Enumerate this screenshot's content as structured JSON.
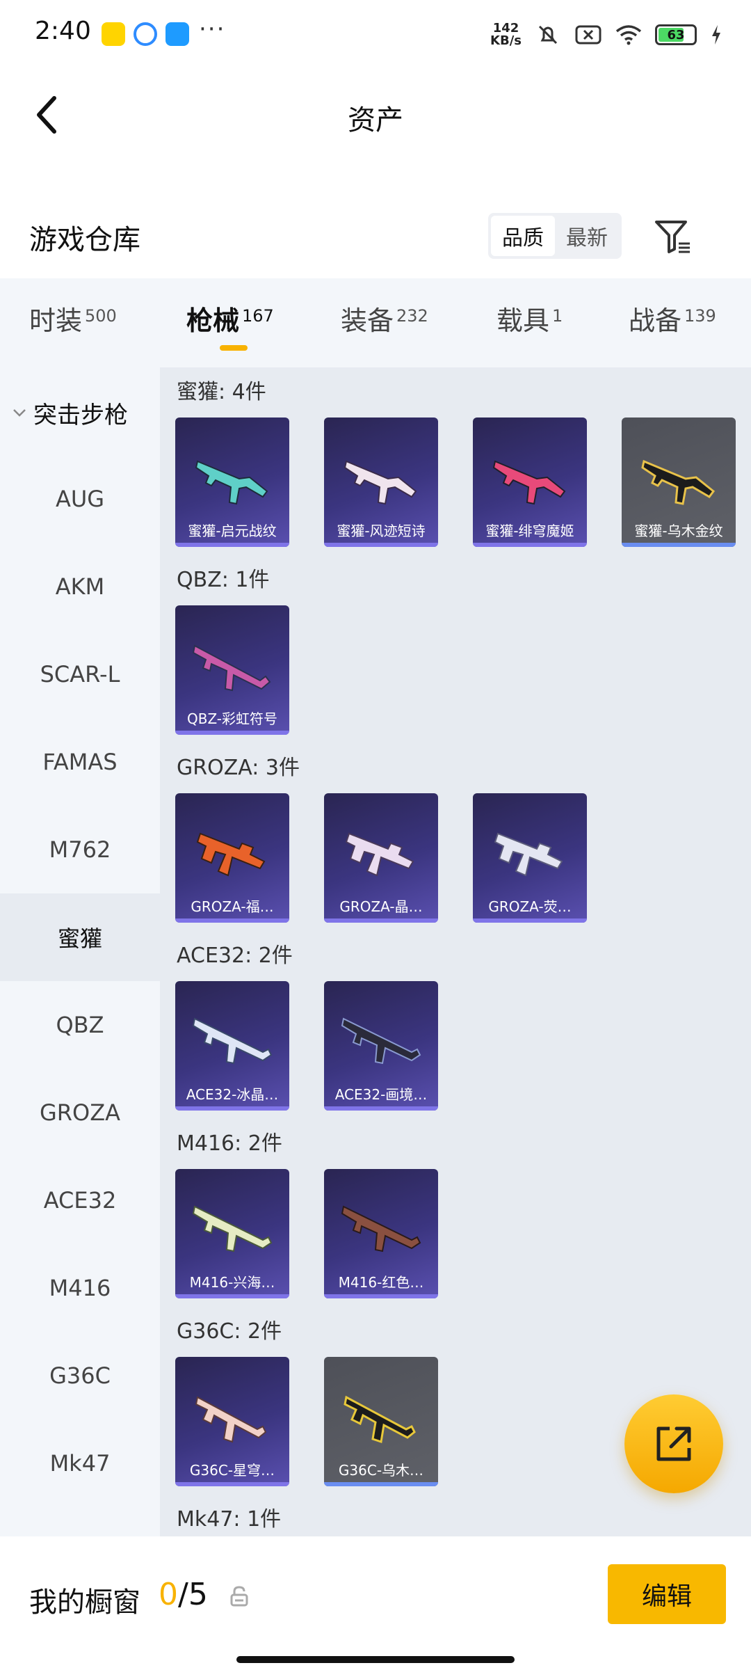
{
  "status_bar": {
    "time": "2:40",
    "net_speed_value": "142",
    "net_speed_unit": "KB/s",
    "battery": "63",
    "icons": [
      "app-icon-1",
      "app-icon-2",
      "app-icon-3",
      "more-dots-icon",
      "mute-icon",
      "no-sim-icon",
      "wifi-icon",
      "battery-icon",
      "charging-icon"
    ]
  },
  "header": {
    "title": "资产",
    "back_icon": "chevron-left-icon"
  },
  "warehouse": {
    "title": "游戏仓库",
    "sort_options": [
      {
        "label": "品质",
        "active": true
      },
      {
        "label": "最新",
        "active": false
      }
    ],
    "filter_icon": "filter-icon"
  },
  "tabs": [
    {
      "label": "时装",
      "count": "500",
      "active": false
    },
    {
      "label": "枪械",
      "count": "167",
      "active": true
    },
    {
      "label": "装备",
      "count": "232",
      "active": false
    },
    {
      "label": "载具",
      "count": "1",
      "active": false
    },
    {
      "label": "战备",
      "count": "139",
      "active": false
    }
  ],
  "sidebar": {
    "group_label": "突击步枪",
    "items": [
      {
        "label": "AUG"
      },
      {
        "label": "AKM"
      },
      {
        "label": "SCAR-L"
      },
      {
        "label": "FAMAS"
      },
      {
        "label": "M762"
      },
      {
        "label": "蜜獾",
        "active": true
      },
      {
        "label": "QBZ"
      },
      {
        "label": "GROZA"
      },
      {
        "label": "ACE32"
      },
      {
        "label": "M416"
      },
      {
        "label": "G36C"
      },
      {
        "label": "Mk47"
      }
    ]
  },
  "sections": [
    {
      "title": "蜜獾: 4件",
      "items": [
        {
          "label": "蜜獾-启元战纹",
          "style": "purple"
        },
        {
          "label": "蜜獾-风迹短诗",
          "style": "purple"
        },
        {
          "label": "蜜獾-绯穹魔姬",
          "style": "purple"
        },
        {
          "label": "蜜獾-乌木金纹",
          "style": "grey"
        }
      ]
    },
    {
      "title": "QBZ: 1件",
      "items": [
        {
          "label": "QBZ-彩虹符号",
          "style": "purple"
        }
      ]
    },
    {
      "title": "GROZA: 3件",
      "items": [
        {
          "label": "GROZA-福…",
          "style": "purple"
        },
        {
          "label": "GROZA-晶…",
          "style": "purple"
        },
        {
          "label": "GROZA-荧…",
          "style": "purple"
        }
      ]
    },
    {
      "title": "ACE32: 2件",
      "items": [
        {
          "label": "ACE32-冰晶…",
          "style": "purple"
        },
        {
          "label": "ACE32-画境…",
          "style": "purple"
        }
      ]
    },
    {
      "title": "M416: 2件",
      "items": [
        {
          "label": "M416-兴海…",
          "style": "purple"
        },
        {
          "label": "M416-红色…",
          "style": "purple"
        }
      ]
    },
    {
      "title": "G36C: 2件",
      "items": [
        {
          "label": "G36C-星穹…",
          "style": "purple"
        },
        {
          "label": "G36C-乌木…",
          "style": "grey"
        }
      ]
    },
    {
      "title": "Mk47: 1件",
      "items": []
    }
  ],
  "fab": {
    "icon": "share-external-icon"
  },
  "bottom_bar": {
    "showcase_label": "我的橱窗",
    "showcase_current": "0",
    "showcase_total": "/5",
    "lock_icon": "lock-icon",
    "edit_label": "编辑"
  },
  "colors": {
    "accent": "#f8b200",
    "panel_bg": "#f3f6fa",
    "content_bg": "#e7ebf1",
    "card_purple": "#3b3580",
    "card_grey": "#5f6168"
  }
}
